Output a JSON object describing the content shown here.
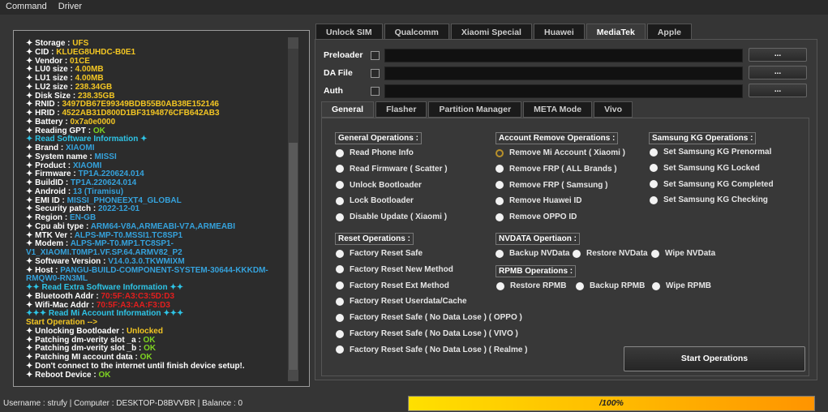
{
  "menu": [
    "Command",
    "Driver"
  ],
  "colors": {
    "key": "#ffffff",
    "yellow": "#f3c623",
    "cyan": "#2ec4e6",
    "blue": "#35a2dc",
    "red": "#e41e1e",
    "green": "#7ed321",
    "progress_start": "#ffe000",
    "progress_end": "#ff9400"
  },
  "log": [
    {
      "k": "✦ Storage : ",
      "v": "UFS",
      "c": "yellow"
    },
    {
      "k": "✦ CID : ",
      "v": "KLUEG8UHDC-B0E1",
      "c": "yellow"
    },
    {
      "k": "✦ Vendor : ",
      "v": "01CE",
      "c": "yellow"
    },
    {
      "k": "✦ LU0 size : ",
      "v": "4.00MB",
      "c": "yellow"
    },
    {
      "k": "✦ LU1 size : ",
      "v": "4.00MB",
      "c": "yellow"
    },
    {
      "k": "✦ LU2 size : ",
      "v": "238.34GB",
      "c": "yellow"
    },
    {
      "k": "✦ Disk Size : ",
      "v": "238.35GB",
      "c": "yellow"
    },
    {
      "k": "✦ RNID : ",
      "v": "3497DB67E99349BDB55B0AB38E152146",
      "c": "yellow"
    },
    {
      "k": "✦ HRID : ",
      "v": "4522AB31D800D1BF3194876CFB642AB3",
      "c": "yellow"
    },
    {
      "k": "✦ Battery : ",
      "v": "0x7a0e0000",
      "c": "yellow"
    },
    {
      "k": "✦ Reading GPT : ",
      "v": "OK",
      "c": "green"
    },
    {
      "k": "",
      "v": "✦ Read Software Information ✦",
      "c": "cyan"
    },
    {
      "k": "✦ Brand : ",
      "v": "XIAOMI",
      "c": "blue"
    },
    {
      "k": "✦ System name : ",
      "v": "MISSI",
      "c": "blue"
    },
    {
      "k": "✦ Product : ",
      "v": "XIAOMI",
      "c": "blue"
    },
    {
      "k": "✦ Firmware : ",
      "v": "TP1A.220624.014",
      "c": "blue"
    },
    {
      "k": "✦ BuildID : ",
      "v": "TP1A.220624.014",
      "c": "blue"
    },
    {
      "k": "✦ Android : ",
      "v": "13 (Tiramisu)",
      "c": "blue"
    },
    {
      "k": "✦ EMI ID : ",
      "v": "MISSI_PHONEEXT4_GLOBAL",
      "c": "blue"
    },
    {
      "k": "✦ Security patch : ",
      "v": "2022-12-01",
      "c": "blue"
    },
    {
      "k": "✦ Region : ",
      "v": "EN-GB",
      "c": "blue"
    },
    {
      "k": "✦ Cpu abi type : ",
      "v": "ARM64-V8A,ARMEABI-V7A,ARMEABI",
      "c": "blue"
    },
    {
      "k": "✦ MTK Ver : ",
      "v": "ALPS-MP-T0.MSSI1.TC8SP1",
      "c": "blue"
    },
    {
      "k": "✦ Modem : ",
      "v": "ALPS-MP-T0.MP1.TC8SP1-V1_XIAOMI.T0MP1.VF.SP.64.ARMV82_P2",
      "c": "blue",
      "wrap": true
    },
    {
      "k": "✦ Software Version : ",
      "v": "V14.0.3.0.TKWMIXM",
      "c": "blue"
    },
    {
      "k": "✦ Host : ",
      "v": "PANGU-BUILD-COMPONENT-SYSTEM-30644-KKKDM-RMQW0-RN3ML",
      "c": "blue",
      "wrap": true
    },
    {
      "k": "",
      "v": "✦✦ Read Extra Software Information ✦✦",
      "c": "cyan"
    },
    {
      "k": "✦ Bluetooth Addr : ",
      "v": "70:5F:A3:C3:5D:D3",
      "c": "red"
    },
    {
      "k": "✦ Wifi-Mac Addr : ",
      "v": "70:5F:A3:AA:F3:D3",
      "c": "red"
    },
    {
      "k": "",
      "v": "✦✦✦ Read Mi Account Information ✦✦✦",
      "c": "cyan"
    },
    {
      "k": "",
      "v": "Start Operation -->",
      "c": "yellow"
    },
    {
      "k": "✦ Unlocking Bootloader : ",
      "v": "Unlocked",
      "c": "yellow"
    },
    {
      "k": "✦ Patching dm-verity slot _a : ",
      "v": "OK",
      "c": "green"
    },
    {
      "k": "✦ Patching dm-verity slot _b : ",
      "v": "OK",
      "c": "green"
    },
    {
      "k": "✦ Patching MI account data : ",
      "v": "OK",
      "c": "green"
    },
    {
      "k": "✦ Don't connect to the internet until finish device setup!.",
      "v": "",
      "c": "key"
    },
    {
      "k": "✦ Reboot Device : ",
      "v": "OK",
      "c": "green"
    }
  ],
  "tabs": [
    {
      "label": "Unlock SIM"
    },
    {
      "label": "Qualcomm"
    },
    {
      "label": "Xiaomi Special"
    },
    {
      "label": "Huawei"
    },
    {
      "label": "MediaTek",
      "active": true
    },
    {
      "label": "Apple"
    }
  ],
  "files": [
    {
      "label": "Preloader",
      "value": "",
      "browse": "..."
    },
    {
      "label": "DA File",
      "value": "",
      "browse": "..."
    },
    {
      "label": "Auth",
      "value": "",
      "browse": "..."
    }
  ],
  "subtabs": [
    {
      "label": "General",
      "active": true
    },
    {
      "label": "Flasher"
    },
    {
      "label": "Partition Manager"
    },
    {
      "label": "META Mode"
    },
    {
      "label": "Vivo"
    }
  ],
  "groups": {
    "general": {
      "title": "General Operations :",
      "items": [
        "Read Phone Info",
        "Read Firmware ( Scatter )",
        "Unlock Bootloader",
        "Lock Bootloader",
        "Disable Update ( Xiaomi )"
      ]
    },
    "account": {
      "title": "Account Remove Operations :",
      "items": [
        "Remove Mi Account ( Xiaomi )",
        "Remove FRP ( ALL Brands )",
        "Remove FRP ( Samsung )",
        "Remove Huawei ID",
        "Remove OPPO ID"
      ],
      "selected": 0
    },
    "samsung": {
      "title": "Samsung KG Operations :",
      "items": [
        "Set Samsung KG Prenormal",
        "Set Samsung KG Locked",
        "Set Samsung KG Completed",
        "Set Samsung KG Checking"
      ]
    },
    "reset": {
      "title": "Reset Operations :",
      "items": [
        "Factory Reset Safe",
        "Factory Reset New Method",
        "Factory Reset Ext Method",
        "Factory Reset Userdata/Cache",
        "Factory Reset Safe ( No Data Lose ) ( OPPO )",
        "Factory Reset Safe ( No Data Lose ) ( VIVO )",
        "Factory Reset Safe ( No Data Lose ) ( Realme )"
      ]
    },
    "nvdata": {
      "title": "NVDATA Opertiaon :",
      "items": [
        "Backup NVData",
        "Restore NVData",
        "Wipe NVData"
      ]
    },
    "rpmb": {
      "title": "RPMB Operations :",
      "items": [
        "Restore RPMB",
        "Backup RPMB",
        "Wipe RPMB"
      ]
    }
  },
  "start_button": "Start Operations",
  "status": "Username : strufy | Computer : DESKTOP-D8BVVBR | Balance : 0",
  "progress": {
    "percent": 100,
    "label": "/100%"
  }
}
